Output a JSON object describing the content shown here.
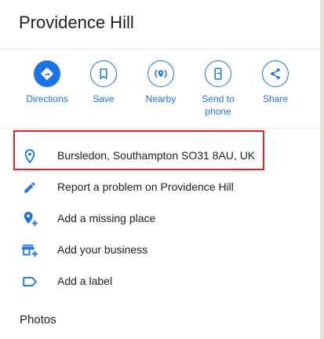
{
  "place": {
    "title": "Providence Hill"
  },
  "actions": [
    {
      "label": "Directions",
      "icon": "directions-icon"
    },
    {
      "label": "Save",
      "icon": "bookmark-icon"
    },
    {
      "label": "Nearby",
      "icon": "nearby-icon"
    },
    {
      "label": "Send to\nphone",
      "icon": "phone-icon"
    },
    {
      "label": "Share",
      "icon": "share-icon"
    }
  ],
  "details": [
    {
      "text": "Bursledon, Southampton SO31 8AU, UK",
      "icon": "location-pin-icon"
    },
    {
      "text": "Report a problem on Providence Hill",
      "icon": "pencil-icon"
    },
    {
      "text": "Add a missing place",
      "icon": "add-place-icon"
    },
    {
      "text": "Add your business",
      "icon": "storefront-add-icon"
    },
    {
      "text": "Add a label",
      "icon": "label-icon"
    }
  ],
  "photos": {
    "heading": "Photos"
  },
  "colors": {
    "accent": "#1a73e8",
    "highlight": "#e8221c",
    "text": "#202124"
  }
}
